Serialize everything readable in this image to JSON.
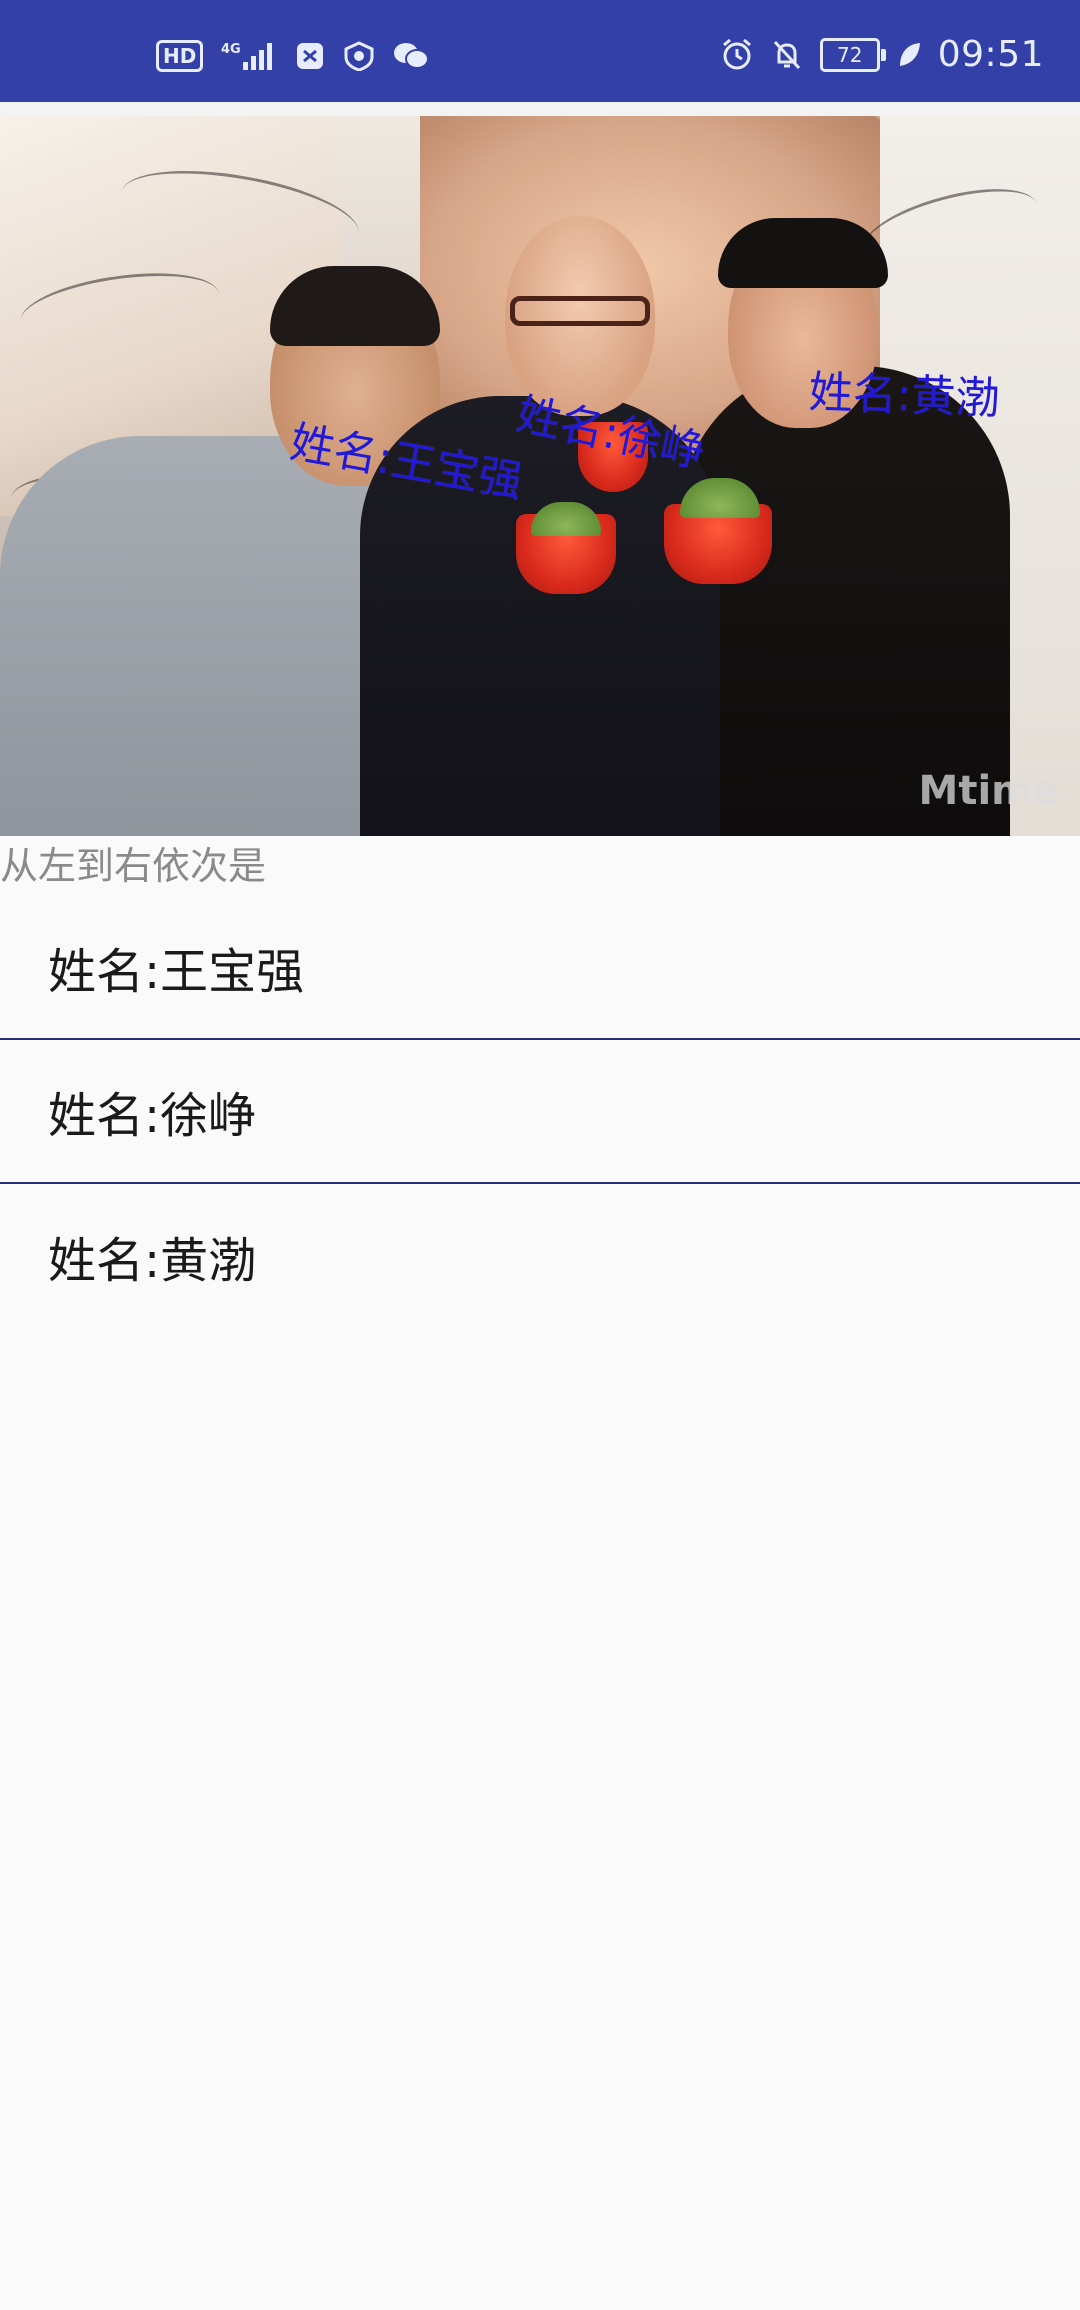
{
  "status_bar": {
    "hd_label": "HD",
    "network_label": "4G",
    "battery_level": "72",
    "time": "09:51"
  },
  "photo": {
    "watermark": "Mtime",
    "tags": [
      {
        "text": "姓名:王宝强"
      },
      {
        "text": "姓名:徐峥"
      },
      {
        "text": "姓名:黄渤"
      }
    ]
  },
  "caption": "从左到右依次是",
  "list": {
    "items": [
      {
        "label": "姓名:王宝强"
      },
      {
        "label": "姓名:徐峥"
      },
      {
        "label": "姓名:黄渤"
      }
    ]
  },
  "colors": {
    "status_bar": "#3240a8",
    "tag_text": "#2219d6",
    "divider": "#2b2f78"
  }
}
